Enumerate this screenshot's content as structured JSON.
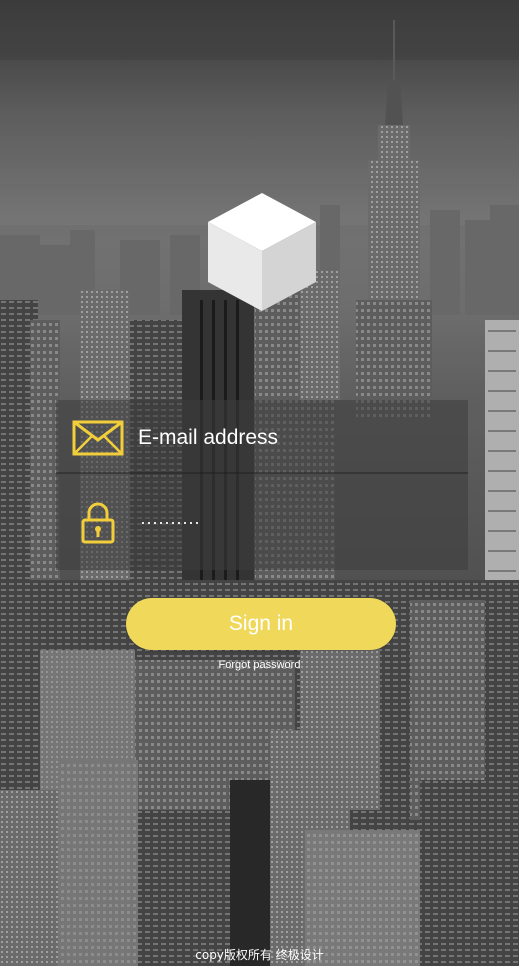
{
  "background": {
    "description_icon": "city-skyline-background",
    "tone": "#5c5c5c"
  },
  "logo": {
    "icon": "cube-icon"
  },
  "form": {
    "email": {
      "icon": "envelope-icon",
      "placeholder": "E-mail address",
      "value": ""
    },
    "password": {
      "icon": "padlock-icon",
      "mask": "··········"
    }
  },
  "actions": {
    "signin_label": "Sign in",
    "forgot_label": "Forgot password"
  },
  "footer": {
    "copyright": "copy版权所有    终极设计"
  },
  "colors": {
    "accent": "#efd85a",
    "icon": "#f2cf3a"
  }
}
